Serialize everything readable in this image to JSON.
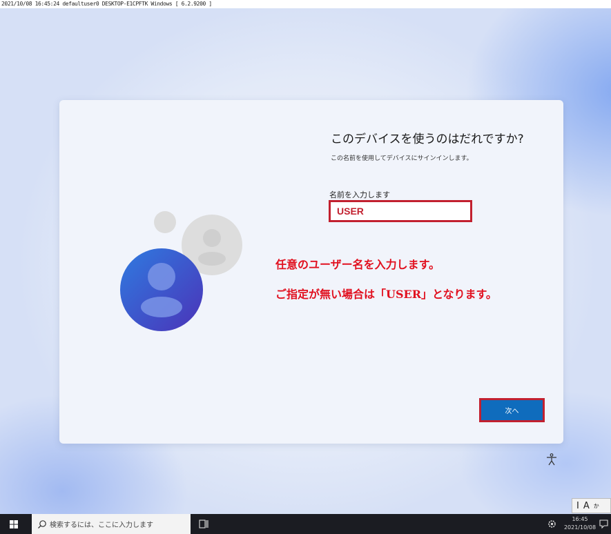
{
  "header": {
    "session_info": "2021/10/08 16:45:24 defaultuser0 DESKTOP-E1CPFTK Windows [ 6.2.9200 ]"
  },
  "dialog": {
    "title": "このデバイスを使うのはだれですか?",
    "subtitle": "この名前を使用してデバイスにサインインします。",
    "name_label": "名前を入力します",
    "name_value": "USER",
    "next_label": "次へ"
  },
  "annotation": {
    "line1": "任意のユーザー名を入力します。",
    "line2": "ご指定が無い場合は「USER」となります。",
    "color": "#e1101f"
  },
  "ime": {
    "mode1": "I",
    "mode2": "A",
    "mode3": "か"
  },
  "taskbar": {
    "search_placeholder": "検索するには、ここに入力します",
    "time": "16:45",
    "date": "2021/10/08"
  },
  "colors": {
    "accent_button": "#0f6cbd",
    "highlight_border": "#c2202f"
  }
}
